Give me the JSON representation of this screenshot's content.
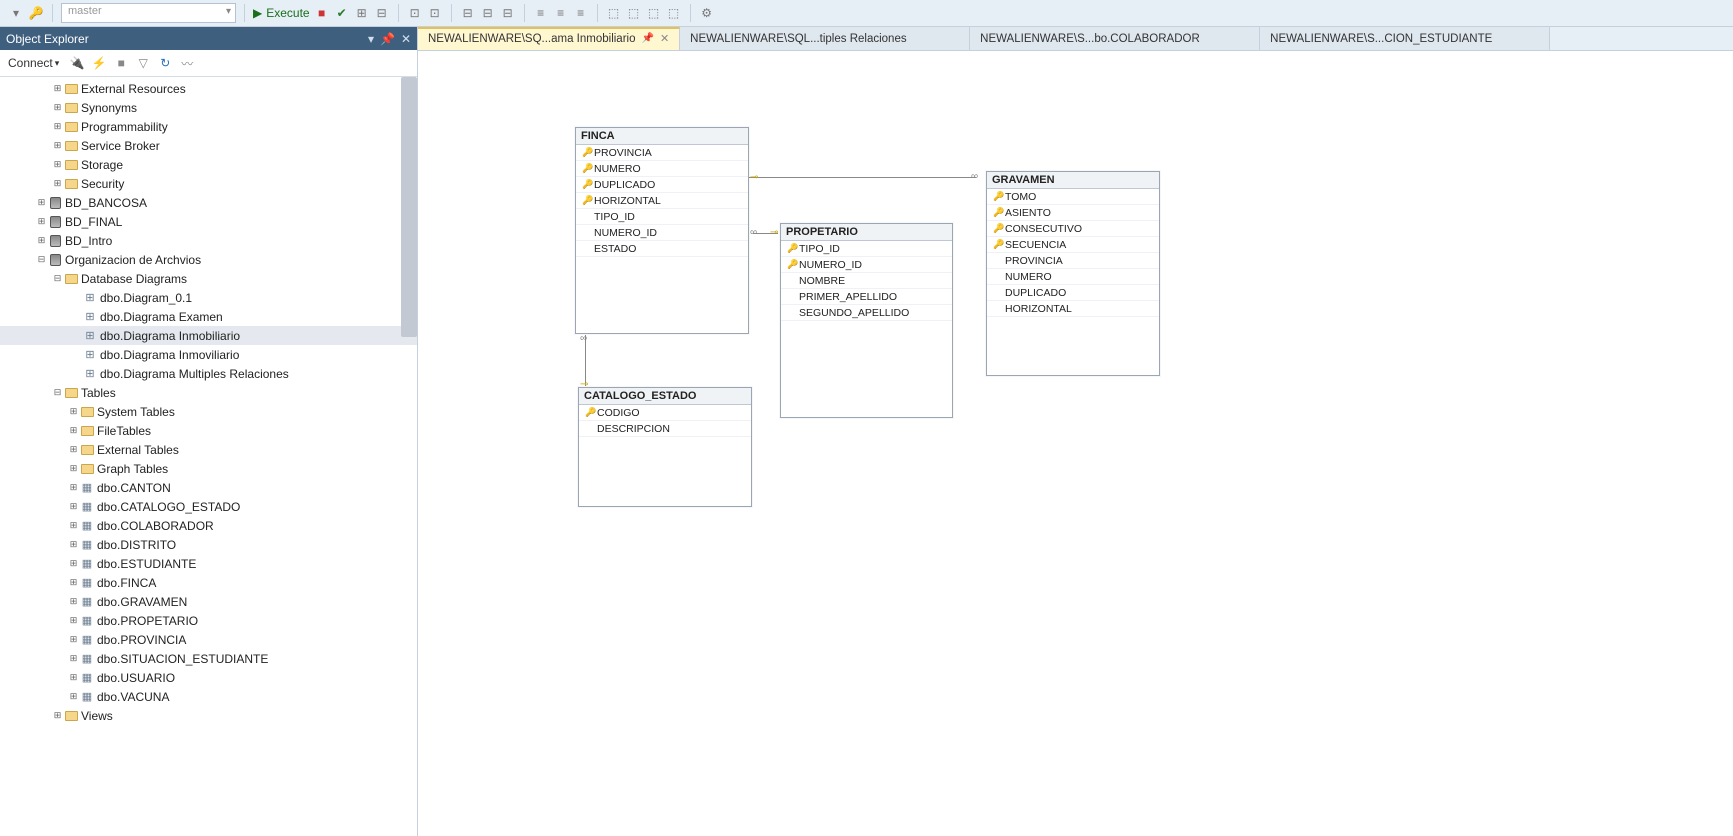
{
  "toolbar": {
    "dropdown_value": "master",
    "execute_label": "Execute"
  },
  "panel": {
    "title": "Object Explorer"
  },
  "connect": {
    "label": "Connect"
  },
  "tree": {
    "folders": {
      "external_resources": "External Resources",
      "synonyms": "Synonyms",
      "programmability": "Programmability",
      "service_broker": "Service Broker",
      "storage": "Storage",
      "security": "Security"
    },
    "dbs": {
      "bancosa": "BD_BANCOSA",
      "final": "BD_FINAL",
      "intro": "BD_Intro",
      "org": "Organizacion de Archvios"
    },
    "org": {
      "diagrams": "Database Diagrams",
      "diagram_items": [
        "dbo.Diagram_0.1",
        "dbo.Diagrama Examen",
        "dbo.Diagrama Inmobiliario",
        "dbo.Diagrama Inmoviliario",
        "dbo.Diagrama Multiples Relaciones"
      ],
      "tables": "Tables",
      "table_folders": [
        "System Tables",
        "FileTables",
        "External Tables",
        "Graph Tables"
      ],
      "table_items": [
        "dbo.CANTON",
        "dbo.CATALOGO_ESTADO",
        "dbo.COLABORADOR",
        "dbo.DISTRITO",
        "dbo.ESTUDIANTE",
        "dbo.FINCA",
        "dbo.GRAVAMEN",
        "dbo.PROPETARIO",
        "dbo.PROVINCIA",
        "dbo.SITUACION_ESTUDIANTE",
        "dbo.USUARIO",
        "dbo.VACUNA"
      ],
      "views": "Views"
    }
  },
  "tabs": [
    {
      "label": "NEWALIENWARE\\SQ...ama Inmobiliario",
      "active": true,
      "closable": true,
      "pin": true
    },
    {
      "label": "NEWALIENWARE\\SQL...tiples Relaciones",
      "active": false
    },
    {
      "label": "NEWALIENWARE\\S...bo.COLABORADOR",
      "active": false
    },
    {
      "label": "NEWALIENWARE\\S...CION_ESTUDIANTE",
      "active": false
    }
  ],
  "diagram": {
    "finca": {
      "name": "FINCA",
      "cols": [
        {
          "n": "PROVINCIA",
          "k": true
        },
        {
          "n": "NUMERO",
          "k": true
        },
        {
          "n": "DUPLICADO",
          "k": true
        },
        {
          "n": "HORIZONTAL",
          "k": true
        },
        {
          "n": "TIPO_ID",
          "k": false
        },
        {
          "n": "NUMERO_ID",
          "k": false
        },
        {
          "n": "ESTADO",
          "k": false
        }
      ]
    },
    "propetario": {
      "name": "PROPETARIO",
      "cols": [
        {
          "n": "TIPO_ID",
          "k": true
        },
        {
          "n": "NUMERO_ID",
          "k": true
        },
        {
          "n": "NOMBRE",
          "k": false
        },
        {
          "n": "PRIMER_APELLIDO",
          "k": false
        },
        {
          "n": "SEGUNDO_APELLIDO",
          "k": false
        }
      ]
    },
    "gravamen": {
      "name": "GRAVAMEN",
      "cols": [
        {
          "n": "TOMO",
          "k": true
        },
        {
          "n": "ASIENTO",
          "k": true
        },
        {
          "n": "CONSECUTIVO",
          "k": true
        },
        {
          "n": "SECUENCIA",
          "k": true
        },
        {
          "n": "PROVINCIA",
          "k": false
        },
        {
          "n": "NUMERO",
          "k": false
        },
        {
          "n": "DUPLICADO",
          "k": false
        },
        {
          "n": "HORIZONTAL",
          "k": false
        }
      ]
    },
    "catalogo": {
      "name": "CATALOGO_ESTADO",
      "cols": [
        {
          "n": "CODIGO",
          "k": true
        },
        {
          "n": "DESCRIPCION",
          "k": false
        }
      ]
    }
  }
}
